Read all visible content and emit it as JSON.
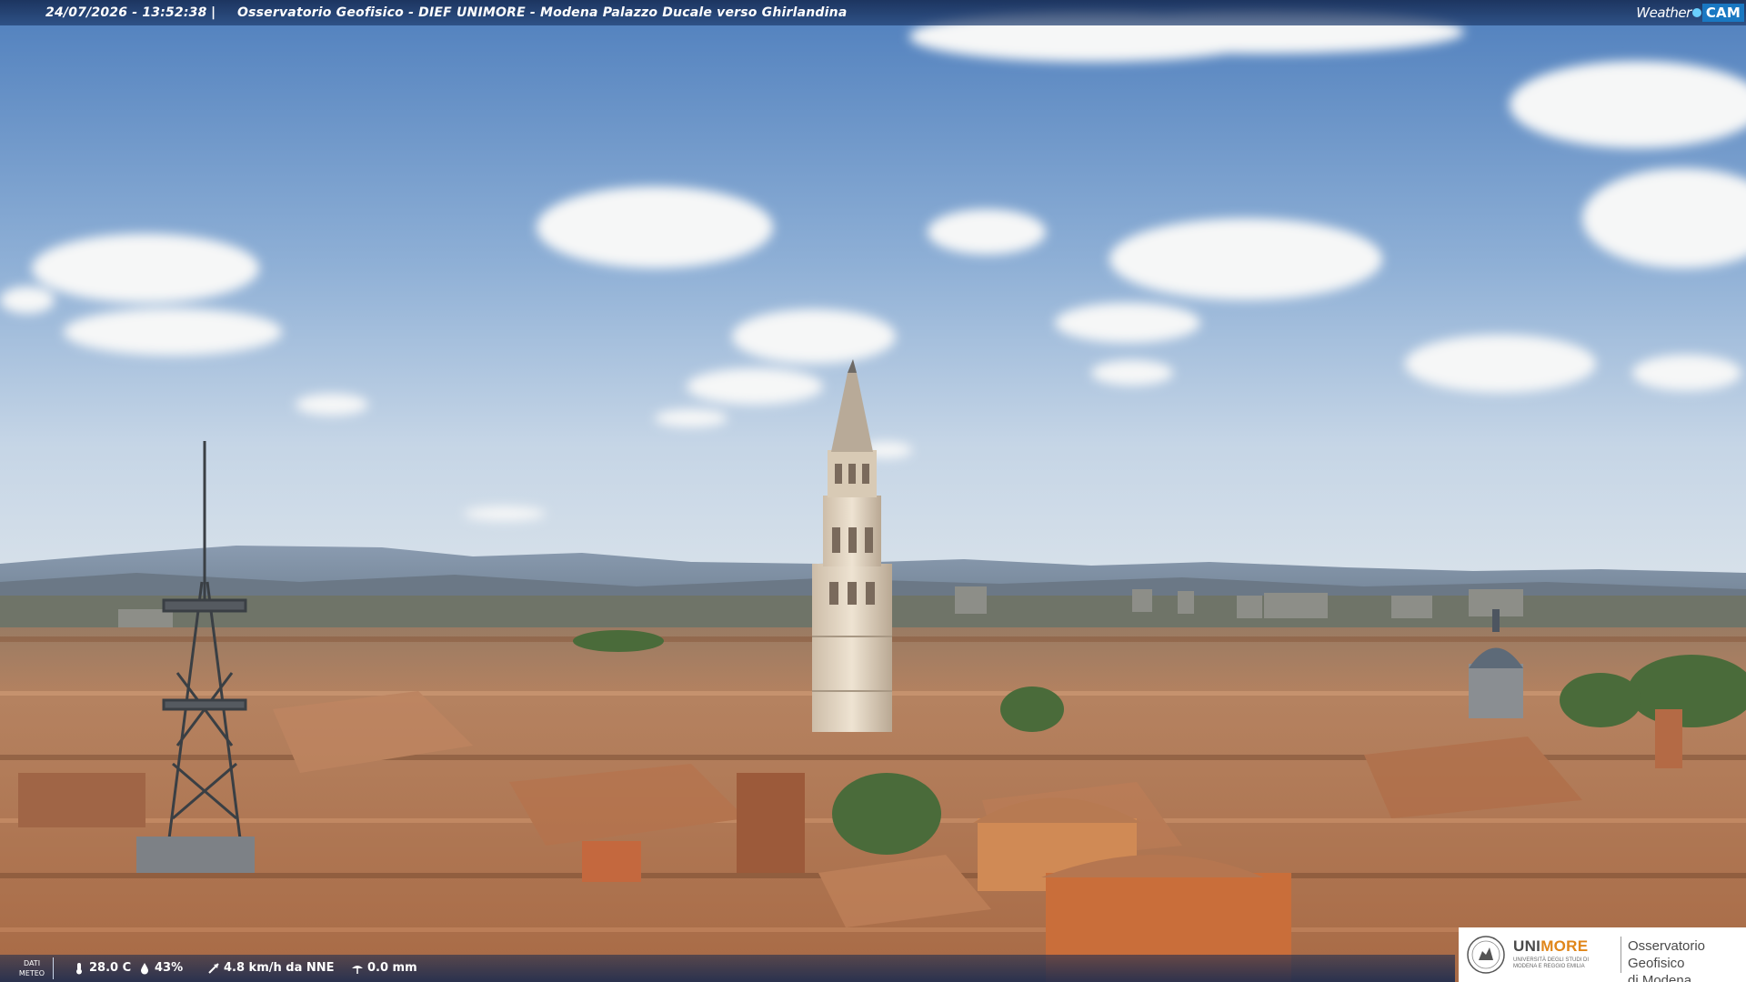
{
  "overlay": {
    "timestamp": "24/07/2026 - 13:52:38",
    "separator": "|",
    "location": "Osservatorio Geofisico - DIEF UNIMORE - Modena Palazzo Ducale verso Ghirlandina",
    "brand": {
      "weather": "Weather",
      "cam": "CAM"
    }
  },
  "weather_bar": {
    "label_line1": "DATI",
    "label_line2": "METEO",
    "temperature": "28.0 C",
    "humidity": "43%",
    "wind": "4.8 km/h da NNE",
    "rain": "0.0 mm",
    "icons": [
      "thermometer-icon",
      "humidity-icon",
      "wind-icon",
      "rain-icon"
    ]
  },
  "logo": {
    "uni_part1": "UNI",
    "uni_part2": "MORE",
    "uni_sub": "UNIVERSITÀ DEGLI STUDI DI MODENA E REGGIO EMILIA",
    "observatory_line1": "Osservatorio Geofisico",
    "observatory_line2": "di Modena"
  },
  "colors": {
    "sky_top": "#5b86bf",
    "sky_bottom": "#c9d8e8",
    "roof": "#b4784f",
    "tower": "#e3d6c4",
    "unimore_orange": "#e0861a"
  }
}
